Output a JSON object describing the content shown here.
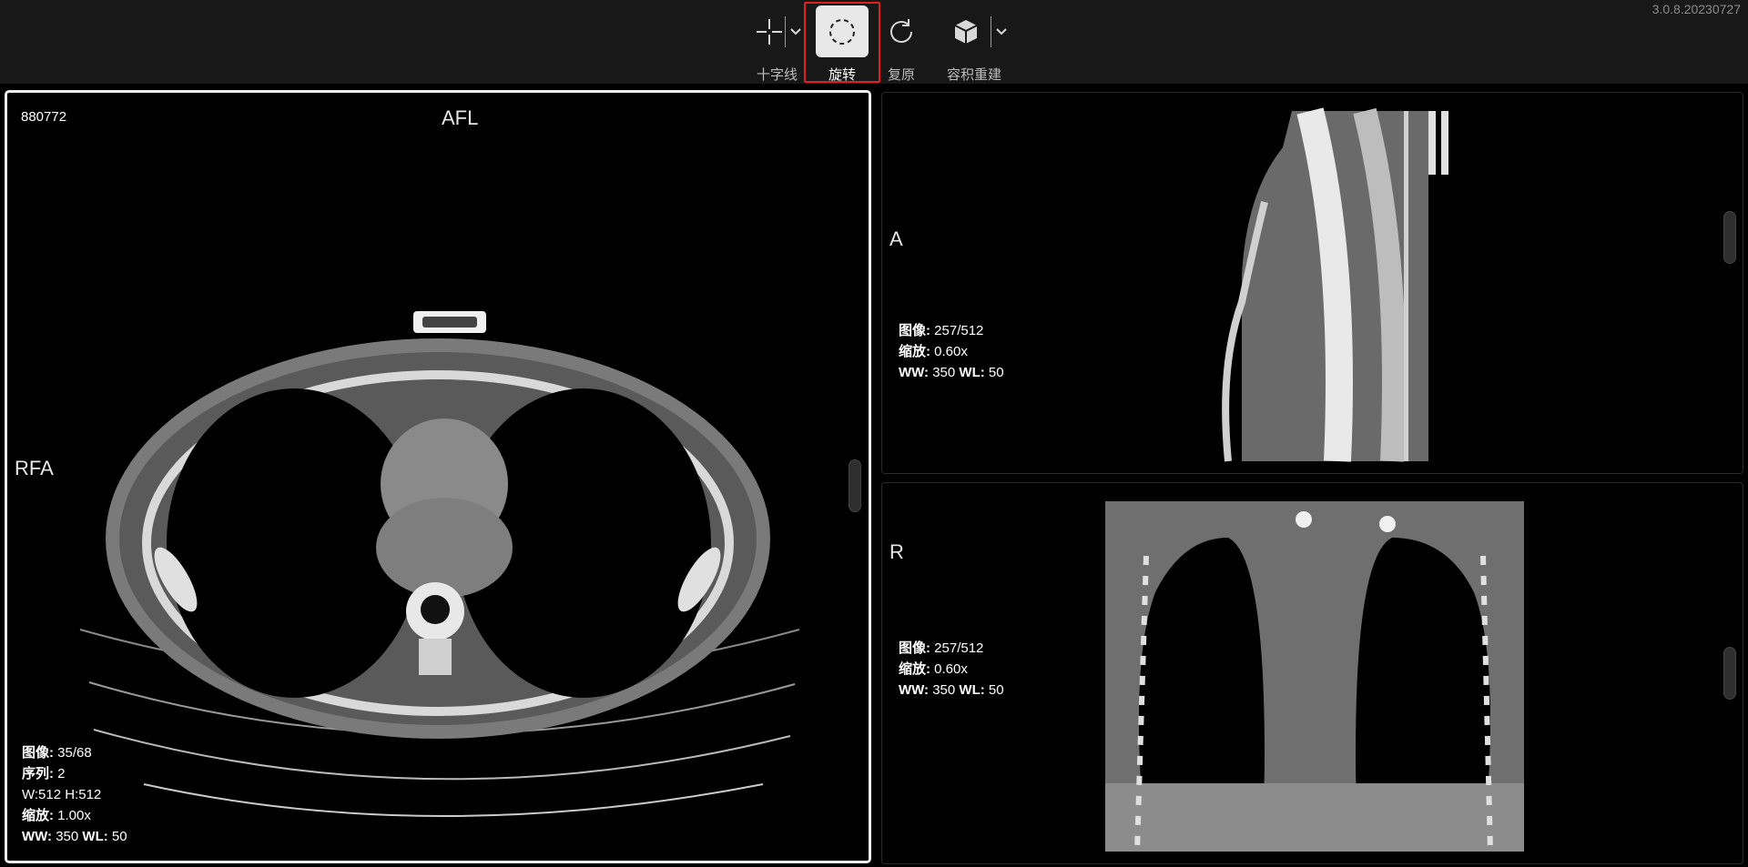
{
  "app": {
    "version": "3.0.8.20230727"
  },
  "toolbar": {
    "crosshair": {
      "label": "十字线",
      "icon": "crosshair-icon"
    },
    "rotate": {
      "label": "旋转",
      "icon": "rotate-dashed-circle-icon",
      "active": true
    },
    "reset": {
      "label": "复原",
      "icon": "reset-icon"
    },
    "volume": {
      "label": "容积重建",
      "icon": "cube-icon"
    }
  },
  "main_view": {
    "patient_id": "880772",
    "orient_top": "AFL",
    "orient_left": "RFA",
    "info": {
      "image_label": "图像:",
      "image_value": "35/68",
      "series_label": "序列:",
      "series_value": "2",
      "size": "W:512 H:512",
      "zoom_label": "缩放:",
      "zoom_value": "1.00x",
      "ww_label": "WW:",
      "ww_value": "350",
      "wl_label": "WL:",
      "wl_value": "50"
    }
  },
  "sagittal_view": {
    "orient_left": "A",
    "info": {
      "image_label": "图像:",
      "image_value": "257/512",
      "zoom_label": "缩放:",
      "zoom_value": "0.60x",
      "ww_label": "WW:",
      "ww_value": "350",
      "wl_label": "WL:",
      "wl_value": "50"
    }
  },
  "coronal_view": {
    "orient_left": "R",
    "info": {
      "image_label": "图像:",
      "image_value": "257/512",
      "zoom_label": "缩放:",
      "zoom_value": "0.60x",
      "ww_label": "WW:",
      "ww_value": "350",
      "wl_label": "WL:",
      "wl_value": "50"
    }
  },
  "colors": {
    "accent_highlight": "#e02020",
    "active_tool_bg": "#e8e8e8",
    "toolbar_bg": "#181818"
  }
}
